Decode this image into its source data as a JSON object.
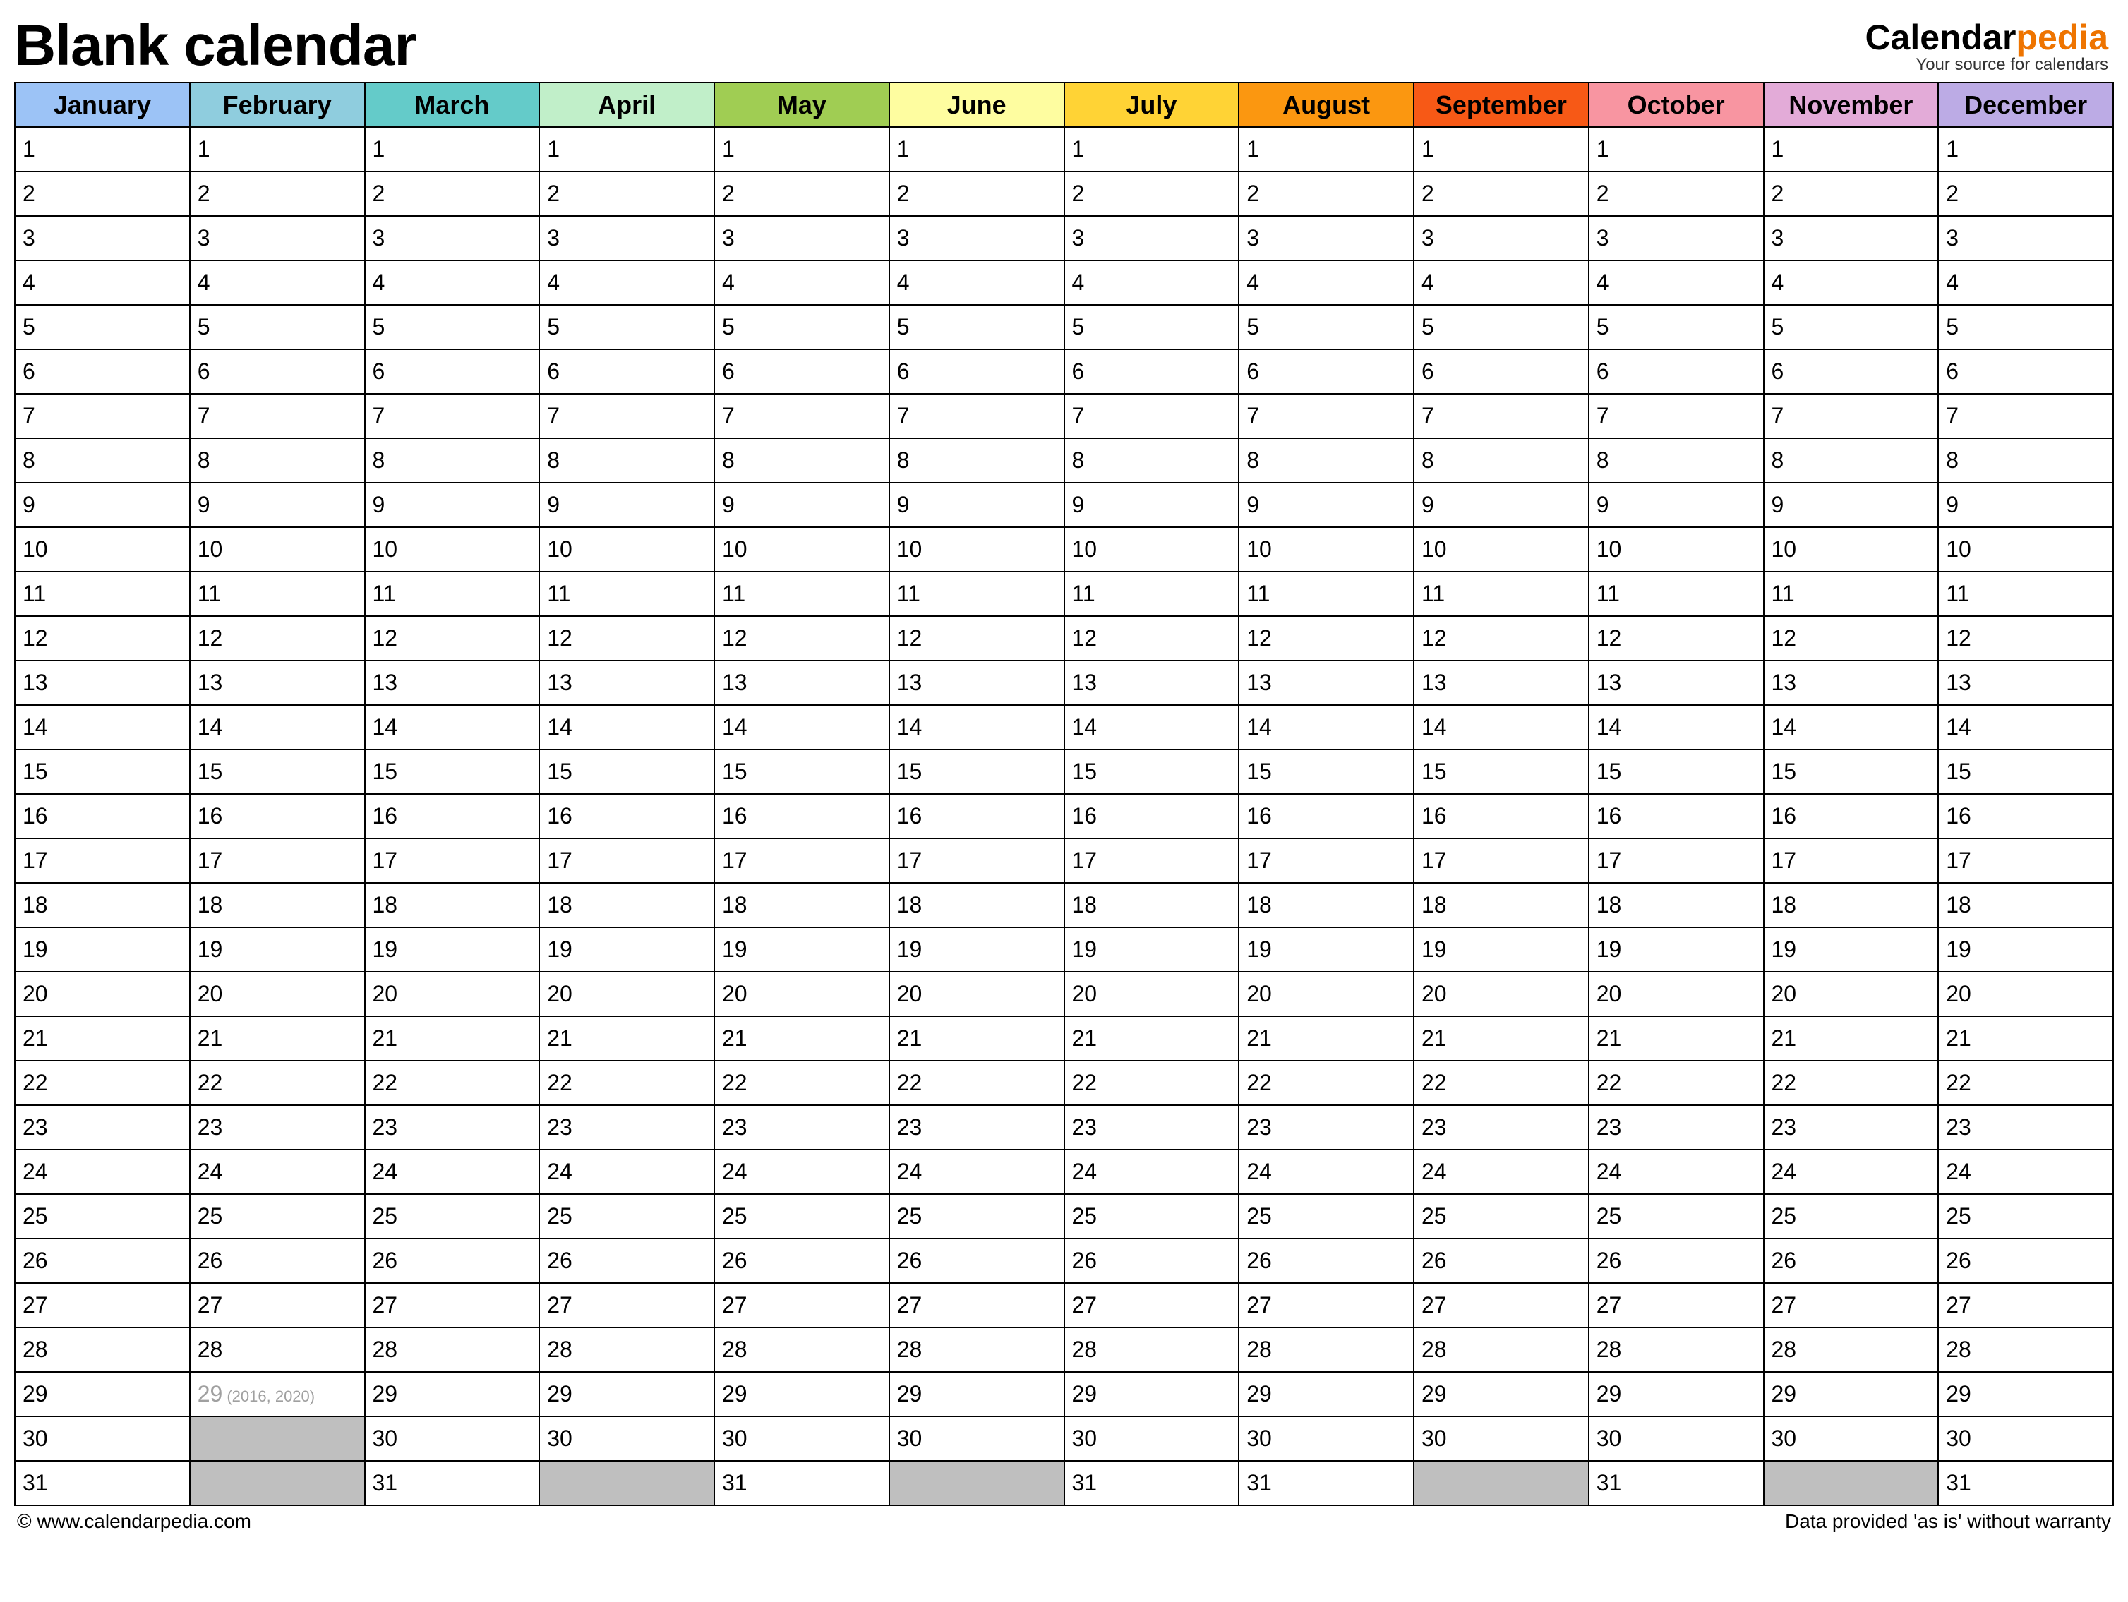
{
  "title": "Blank calendar",
  "brand": {
    "name_part1": "Calendar",
    "name_part2": "pedia",
    "tagline": "Your source for calendars"
  },
  "months": [
    {
      "label": "January",
      "color": "#9cc3f6",
      "days": 31
    },
    {
      "label": "February",
      "color": "#8fcdde",
      "days": 29,
      "leap_day": 29,
      "leap_note": "(2016, 2020)"
    },
    {
      "label": "March",
      "color": "#64cbc9",
      "days": 31
    },
    {
      "label": "April",
      "color": "#c1efc9",
      "days": 30
    },
    {
      "label": "May",
      "color": "#a0cd53",
      "days": 31
    },
    {
      "label": "June",
      "color": "#fefda0",
      "days": 30
    },
    {
      "label": "July",
      "color": "#ffd335",
      "days": 31
    },
    {
      "label": "August",
      "color": "#fb9710",
      "days": 31
    },
    {
      "label": "September",
      "color": "#f75916",
      "days": 30
    },
    {
      "label": "October",
      "color": "#f895a1",
      "days": 31
    },
    {
      "label": "November",
      "color": "#e3abd8",
      "days": 30
    },
    {
      "label": "December",
      "color": "#bcabe5",
      "days": 31
    }
  ],
  "max_rows": 31,
  "footer": {
    "left": "© www.calendarpedia.com",
    "right": "Data provided 'as is' without warranty"
  }
}
